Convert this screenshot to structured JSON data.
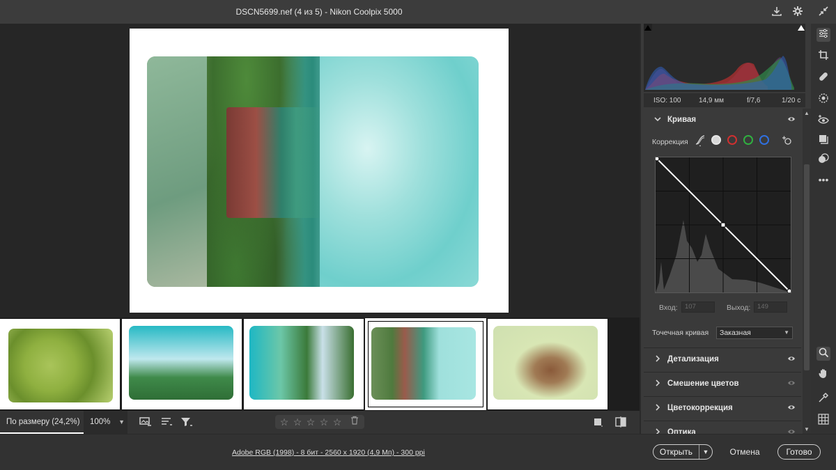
{
  "window": {
    "title": "DSCN5699.nef (4 из 5)  -  Nikon Coolpix 5000"
  },
  "titlebar_icons": [
    "save-icon",
    "gear-icon",
    "collapse-icon"
  ],
  "exif": {
    "iso": "ISO: 100",
    "focal": "14,9 мм",
    "aperture": "f/7,6",
    "shutter": "1/20 с"
  },
  "curve_panel": {
    "title": "Кривая",
    "correction_label": "Коррекция",
    "channels": [
      "parametric",
      "point-white",
      "red",
      "green",
      "blue"
    ],
    "input_label": "Вход:",
    "input_value": "107",
    "output_label": "Выход:",
    "output_value": "149",
    "point_curve_label": "Точечная кривая",
    "point_curve_value": "Заказная"
  },
  "sections": [
    {
      "label": "Детализация",
      "eye": "visible"
    },
    {
      "label": "Смешение цветов",
      "eye": "dim"
    },
    {
      "label": "Цветокоррекция",
      "eye": "visible"
    },
    {
      "label": "Оптика",
      "eye": "dim"
    }
  ],
  "filmstrip": {
    "count": 5,
    "selected_index": 3
  },
  "toolbar": {
    "zoom_fit": "По размеру (24,2%)",
    "zoom_100": "100%",
    "rating_stars": 5,
    "rating_value": 0
  },
  "footer": {
    "color_info": "Adobe RGB (1998) - 8 бит - 2560 x 1920 (4,9 Мп) - 300 ppi",
    "open": "Открыть",
    "cancel": "Отмена",
    "done": "Готово"
  },
  "toolrail_icons": [
    "edit-sliders-icon",
    "crop-icon",
    "healing-icon",
    "mask-icon",
    "redeye-icon",
    "snapshots-icon",
    "presets-icon",
    "more-icon",
    "zoom-icon",
    "hand-icon",
    "sampler-icon",
    "grid-icon"
  ],
  "colors": {
    "panel_bg": "#3a3a3a",
    "canvas_bg": "#262626",
    "accent_white": "#ffffff"
  }
}
